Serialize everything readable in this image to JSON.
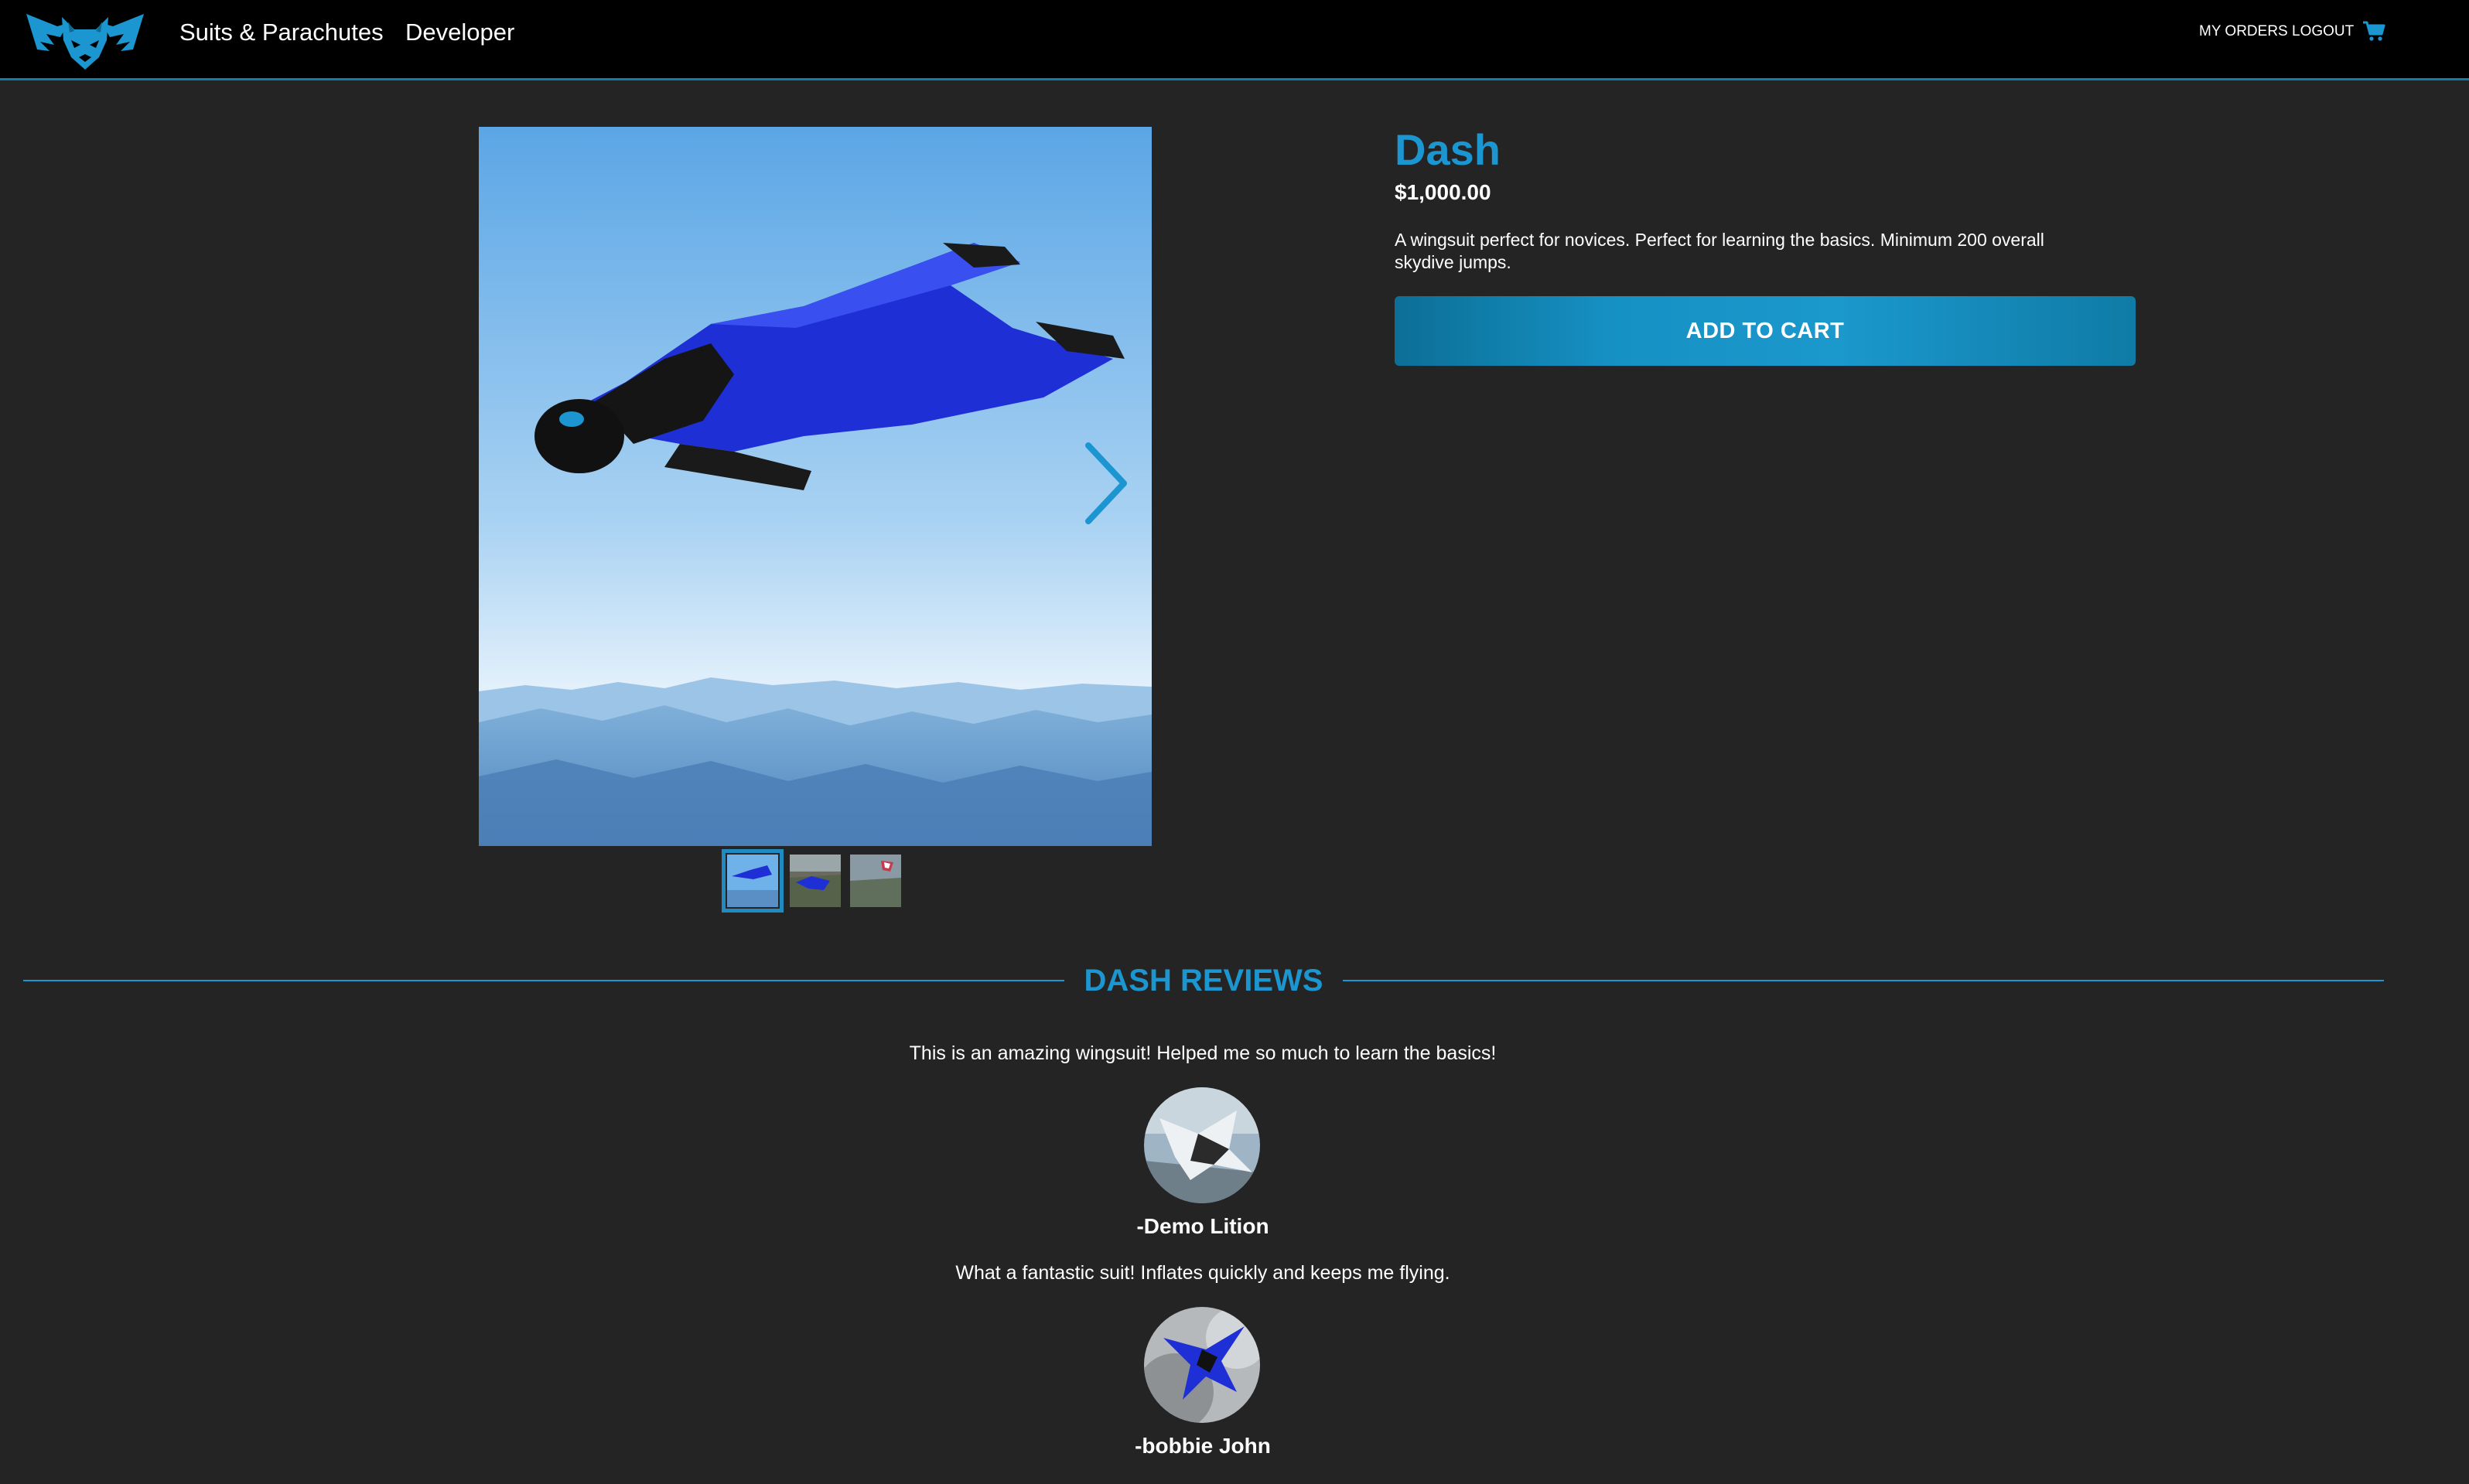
{
  "nav": {
    "logo_icon": "fox-wings-logo-icon",
    "links": [
      "Suits & Parachutes",
      "Developer"
    ],
    "my_orders": "MY ORDERS",
    "logout": "LOGOUT",
    "cart_icon": "cart-icon"
  },
  "product": {
    "name": "Dash",
    "price": "$1,000.00",
    "description": "A wingsuit perfect for novices. Perfect for learning the basics. Minimum 200 overall skydive jumps.",
    "add_to_cart": "ADD TO CART",
    "gallery": {
      "image_count": 3,
      "active_index": 0,
      "next_icon": "chevron-right-icon"
    }
  },
  "reviews": {
    "title": "DASH REVIEWS",
    "items": [
      {
        "text": "This is an amazing wingsuit! Helped me so much to learn the basics!",
        "author": "-Demo Lition"
      },
      {
        "text": "What a fantastic suit! Inflates quickly and keeps me flying.",
        "author": "-bobbie John"
      }
    ]
  },
  "colors": {
    "accent": "#1b96d0",
    "background": "#242424",
    "navbar": "#000000",
    "button": "#1691c4"
  }
}
